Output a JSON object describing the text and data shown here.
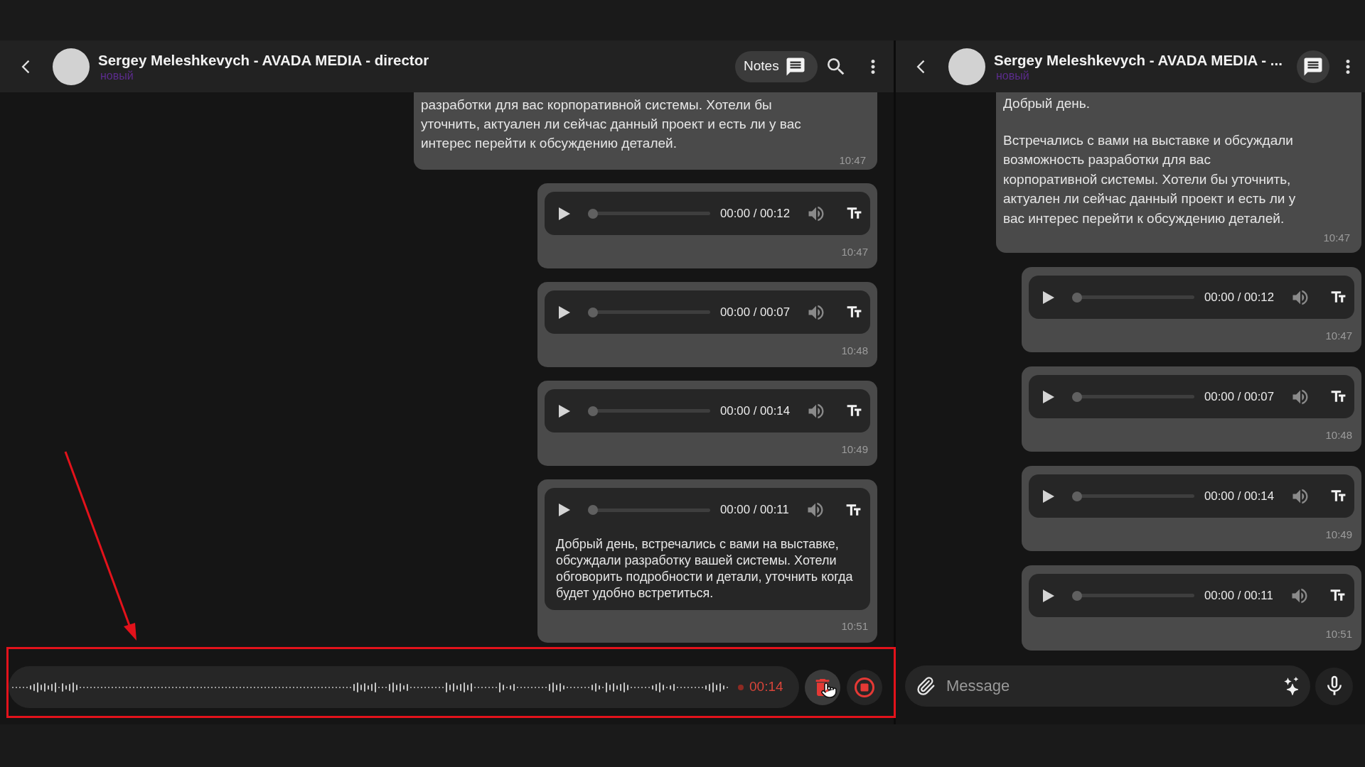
{
  "left_chat": {
    "header": {
      "title": "Sergey Meleshkevych - AVADA MEDIA - director",
      "status": "новый",
      "notes_button": "Notes"
    },
    "messages": [
      {
        "kind": "text",
        "paragraphs": [
          "разработки для вас корпоративной системы. Хотели бы уточнить, актуален ли сейчас данный проект и есть ли у вас интерес перейти к обсуждению деталей."
        ],
        "time": "10:47"
      },
      {
        "kind": "voice",
        "playback": "00:00 / 00:12",
        "level": 0,
        "time": "10:47"
      },
      {
        "kind": "voice",
        "playback": "00:00 / 00:07",
        "level": 0,
        "time": "10:48"
      },
      {
        "kind": "voice",
        "playback": "00:00 / 00:14",
        "level": 0,
        "time": "10:49"
      },
      {
        "kind": "voice",
        "playback": "00:00 / 00:11",
        "level": 0,
        "transcript": "Добрый день, встречались с вами на выставке, обсуждали разработку вашей системы. Хотели обговорить подробности и детали, уточнить когда будет удобно встретиться.",
        "time": "10:51"
      }
    ],
    "recorder": {
      "timer": "00:14"
    }
  },
  "right_chat": {
    "header": {
      "title": "Sergey Meleshkevych - AVADA MEDIA - ...",
      "status": "новый"
    },
    "messages": [
      {
        "kind": "text",
        "paragraphs": [
          "Добрый день.",
          "Встречались с вами на выставке и обсуждали возможность разработки для вас корпоративной системы. Хотели бы уточнить, актуален ли сейчас данный проект и есть ли у вас интерес перейти к обсуждению деталей."
        ],
        "time": "10:47"
      },
      {
        "kind": "voice",
        "playback": "00:00 / 00:12",
        "level": 0,
        "time": "10:47"
      },
      {
        "kind": "voice",
        "playback": "00:00 / 00:07",
        "level": 0,
        "time": "10:48"
      },
      {
        "kind": "voice",
        "playback": "00:00 / 00:14",
        "level": 0,
        "time": "10:49"
      },
      {
        "kind": "voice",
        "playback": "00:00 / 00:11",
        "level": 0,
        "time": "10:51"
      }
    ],
    "composer": {
      "placeholder": "Message"
    }
  }
}
